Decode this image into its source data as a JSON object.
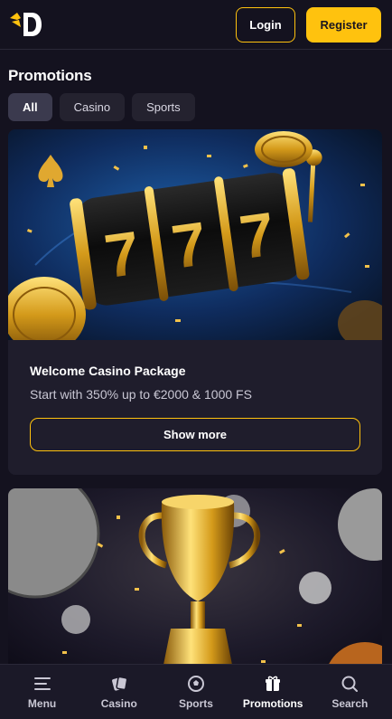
{
  "header": {
    "logo": "D",
    "login_label": "Login",
    "register_label": "Register"
  },
  "page": {
    "title": "Promotions"
  },
  "filters": [
    {
      "label": "All",
      "active": true
    },
    {
      "label": "Casino",
      "active": false
    },
    {
      "label": "Sports",
      "active": false
    }
  ],
  "promotions": [
    {
      "title": "Welcome Casino Package",
      "subtitle": "Start with 350% up to €2000 & 1000 FS",
      "button_label": "Show more",
      "image": "slot-machine-777"
    },
    {
      "image": "golden-trophy"
    }
  ],
  "bottom_nav": [
    {
      "label": "Menu",
      "icon": "menu-icon",
      "active": false
    },
    {
      "label": "Casino",
      "icon": "cards-icon",
      "active": false
    },
    {
      "label": "Sports",
      "icon": "soccer-ball-icon",
      "active": false
    },
    {
      "label": "Promotions",
      "icon": "gift-icon",
      "active": true
    },
    {
      "label": "Search",
      "icon": "search-icon",
      "active": false
    }
  ],
  "colors": {
    "accent": "#ffc20e",
    "background": "#14121f",
    "card": "#1f1d2c",
    "chip": "#24222f",
    "chip_active": "#3b3a4e"
  }
}
